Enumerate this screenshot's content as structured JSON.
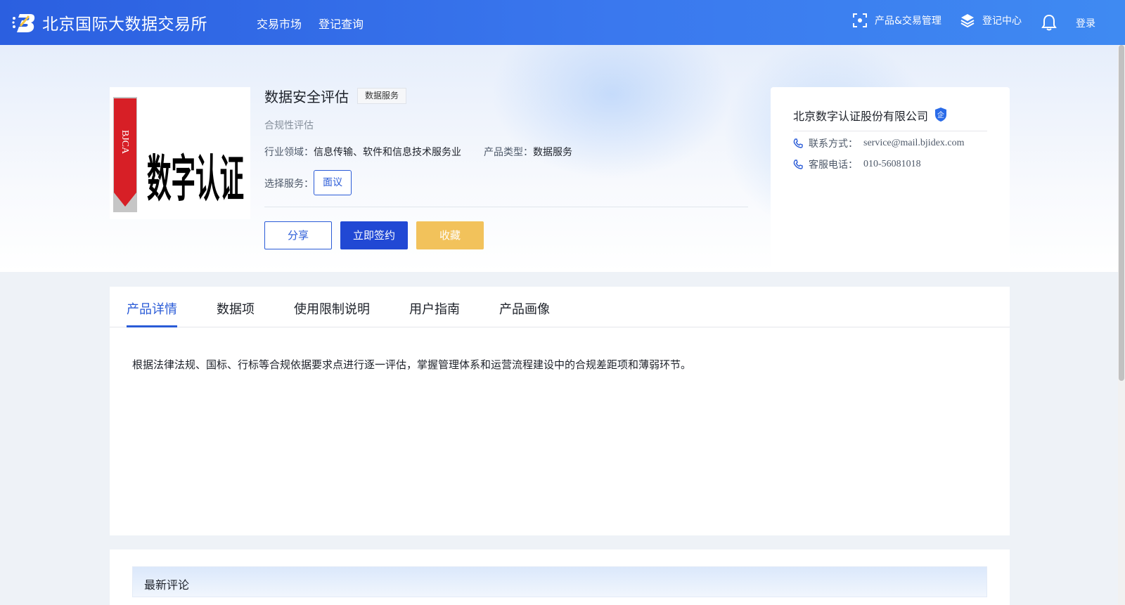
{
  "header": {
    "brand_name": "北京国际大数据交易所",
    "nav": [
      "交易市场",
      "登记查询"
    ],
    "right": {
      "product_mgmt": "产品&交易管理",
      "registry_center": "登记中心",
      "login": "登录"
    }
  },
  "product": {
    "title": "数据安全评估",
    "tag": "数据服务",
    "subtitle": "合规性评估",
    "industry_label": "行业领域：",
    "industry_value": "信息传输、软件和信息技术服务业",
    "type_label": "产品类型：",
    "type_value": "数据服务",
    "service_label": "选择服务：",
    "service_option": "面议",
    "thumb_logo_text": "BJCA",
    "thumb_main_text": "数字认证"
  },
  "actions": {
    "share": "分享",
    "sign": "立即签约",
    "favorite": "收藏"
  },
  "company": {
    "name": "北京数字认证股份有限公司",
    "badge": "企",
    "contact_label": "联系方式：",
    "contact_value": "service@mail.bjidex.com",
    "phone_label": "客服电话：",
    "phone_value": "010-56081018"
  },
  "tabs": [
    "产品详情",
    "数据项",
    "使用限制说明",
    "用户指南",
    "产品画像"
  ],
  "active_tab": "产品详情",
  "detail_text": "根据法律法规、国标、行标等合规依据要求点进行逐一评估，掌握管理体系和运营流程建设中的合规差距项和薄弱环节。",
  "comments": {
    "title": "最新评论"
  },
  "colors": {
    "header_gradient_start": "#2b5fe0",
    "header_gradient_end": "#3f8af2",
    "primary": "#2a5bd7",
    "sign_button": "#2148d4",
    "favorite_button": "#f2c25b"
  }
}
